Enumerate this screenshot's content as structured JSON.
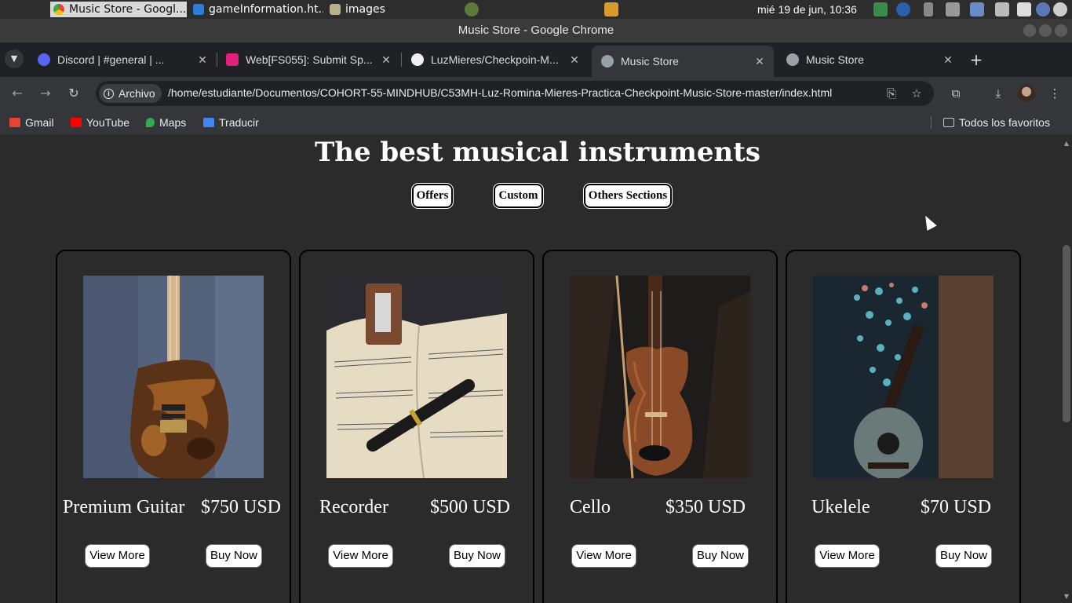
{
  "os_bar": {
    "tasks": [
      {
        "label": "Music Store - Googl...",
        "active": true
      },
      {
        "label": "gameInformation.ht...",
        "active": false
      },
      {
        "label": "images",
        "active": false
      }
    ],
    "clock": "mié 19 de jun, 10:36"
  },
  "window": {
    "title": "Music Store - Google Chrome"
  },
  "tabs": [
    {
      "label": "Discord | #general | ...",
      "icon": "discord-icon"
    },
    {
      "label": "Web[FS055]: Submit Sp...",
      "icon": "app-icon"
    },
    {
      "label": "LuzMieres/Checkpoin-M...",
      "icon": "github-icon"
    },
    {
      "label": "Music Store",
      "icon": "globe-icon",
      "active": true
    },
    {
      "label": "Music Store",
      "icon": "globe-icon"
    }
  ],
  "toolbar": {
    "chip_label": "Archivo",
    "url": "/home/estudiante/Documentos/COHORT-55-MINDHUB/C53MH-Luz-Romina-Mieres-Practica-Checkpoint-Music-Store-master/index.html"
  },
  "bookmarks": {
    "items": [
      {
        "label": "Gmail",
        "icon": "gmail-icon",
        "color": "#ea4335"
      },
      {
        "label": "YouTube",
        "icon": "youtube-icon",
        "color": "#ff0000"
      },
      {
        "label": "Maps",
        "icon": "maps-icon",
        "color": "#34a853"
      },
      {
        "label": "Traducir",
        "icon": "translate-icon",
        "color": "#4285f4"
      }
    ],
    "all_favorites": "Todos los favoritos"
  },
  "page": {
    "heading": "The best musical instruments",
    "nav": [
      "Offers",
      "Custom",
      "Others Sections"
    ],
    "products": [
      {
        "name": "Premium Guitar",
        "price": "$750 USD",
        "view_more": "View More",
        "buy_now": "Buy Now"
      },
      {
        "name": "Recorder",
        "price": "$500 USD",
        "view_more": "View More",
        "buy_now": "Buy Now"
      },
      {
        "name": "Cello",
        "price": "$350 USD",
        "view_more": "View More",
        "buy_now": "Buy Now"
      },
      {
        "name": "Ukelele",
        "price": "$70 USD",
        "view_more": "View More",
        "buy_now": "Buy Now"
      }
    ]
  },
  "colors": {
    "page_bg": "#2b2b2b",
    "chrome_dark": "#202124",
    "chrome_toolbar": "#35363a"
  }
}
